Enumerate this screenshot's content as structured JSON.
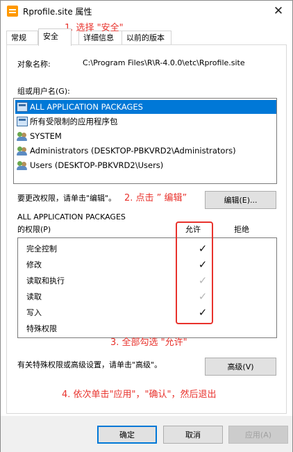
{
  "window": {
    "title": "Rprofile.site 属性",
    "close_glyph": "✕"
  },
  "tabs": [
    {
      "label": "常规"
    },
    {
      "label": "安全"
    },
    {
      "label": "详细信息"
    },
    {
      "label": "以前的版本"
    }
  ],
  "annotations": {
    "step1": "1. 选择 \"安全\"",
    "step2": "2. 点击 ” 编辑”",
    "step3": "3. 全部勾选 \"允许\"",
    "step4": "4. 依次单击\"应用\"，\"确认\"，然后退出"
  },
  "object": {
    "label": "对象名称:",
    "value": "C:\\Program Files\\R\\R-4.0.0\\etc\\Rprofile.site"
  },
  "groups": {
    "label": "组或用户名(G):",
    "items": [
      {
        "name": "ALL APPLICATION PACKAGES",
        "icon": "package-icon",
        "selected": true
      },
      {
        "name": "所有受限制的应用程序包",
        "icon": "package-icon",
        "selected": false
      },
      {
        "name": "SYSTEM",
        "icon": "users-icon",
        "selected": false
      },
      {
        "name": "Administrators (DESKTOP-PBKVRD2\\Administrators)",
        "icon": "users-icon",
        "selected": false
      },
      {
        "name": "Users (DESKTOP-PBKVRD2\\Users)",
        "icon": "users-icon",
        "selected": false
      }
    ]
  },
  "edit": {
    "hint": "要更改权限，请单击\"编辑\"。",
    "button": "编辑(E)..."
  },
  "permissions": {
    "title_line1": "ALL APPLICATION PACKAGES",
    "title_line2": "的权限(P)",
    "allow_header": "允许",
    "deny_header": "拒绝",
    "items": [
      {
        "name": "完全控制",
        "allow": "dark"
      },
      {
        "name": "修改",
        "allow": "dark"
      },
      {
        "name": "读取和执行",
        "allow": "gray"
      },
      {
        "name": "读取",
        "allow": "gray"
      },
      {
        "name": "写入",
        "allow": "dark"
      },
      {
        "name": "特殊权限",
        "allow": "none"
      }
    ],
    "check_glyph": "✓"
  },
  "advanced": {
    "hint": "有关特殊权限或高级设置，请单击\"高级\"。",
    "button": "高级(V)"
  },
  "footer": {
    "ok": "确定",
    "cancel": "取消",
    "apply": "应用(A)"
  }
}
